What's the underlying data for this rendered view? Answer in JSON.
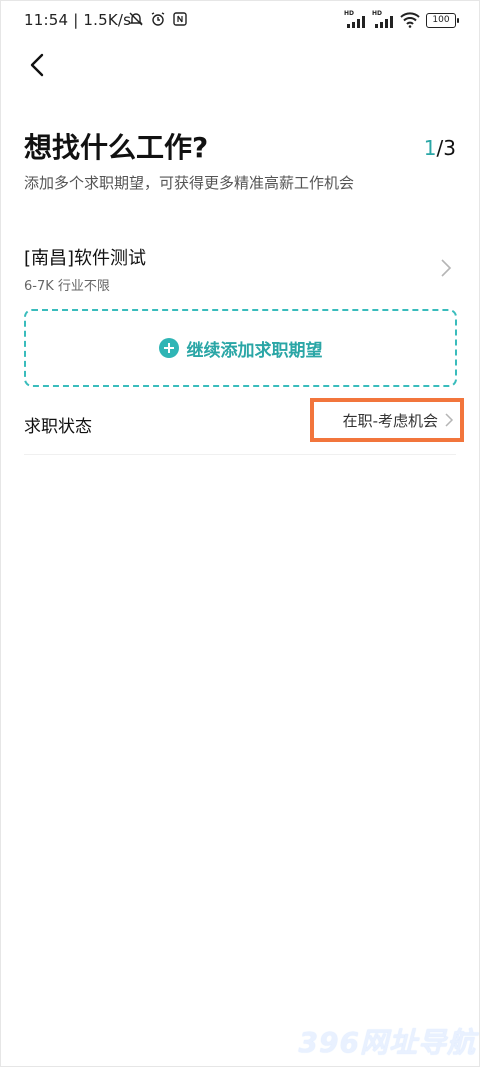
{
  "status_bar": {
    "time": "11:54",
    "speed": "| 1.5K/s",
    "hd_tag": "HD",
    "battery": "100"
  },
  "header": {
    "title": "想找什么工作?",
    "pager_current": "1",
    "pager_total": "/3",
    "subtitle": "添加多个求职期望，可获得更多精准高薪工作机会"
  },
  "expectations": [
    {
      "title": "[南昌]软件测试",
      "detail": "6-7K 行业不限"
    }
  ],
  "add_button": {
    "label": "继续添加求职期望"
  },
  "job_status": {
    "label": "求职状态",
    "value": "在职-考虑机会"
  },
  "watermark": "396网址导航",
  "colors": {
    "accent": "#2aa6a6",
    "highlight_border": "#f2753c"
  }
}
